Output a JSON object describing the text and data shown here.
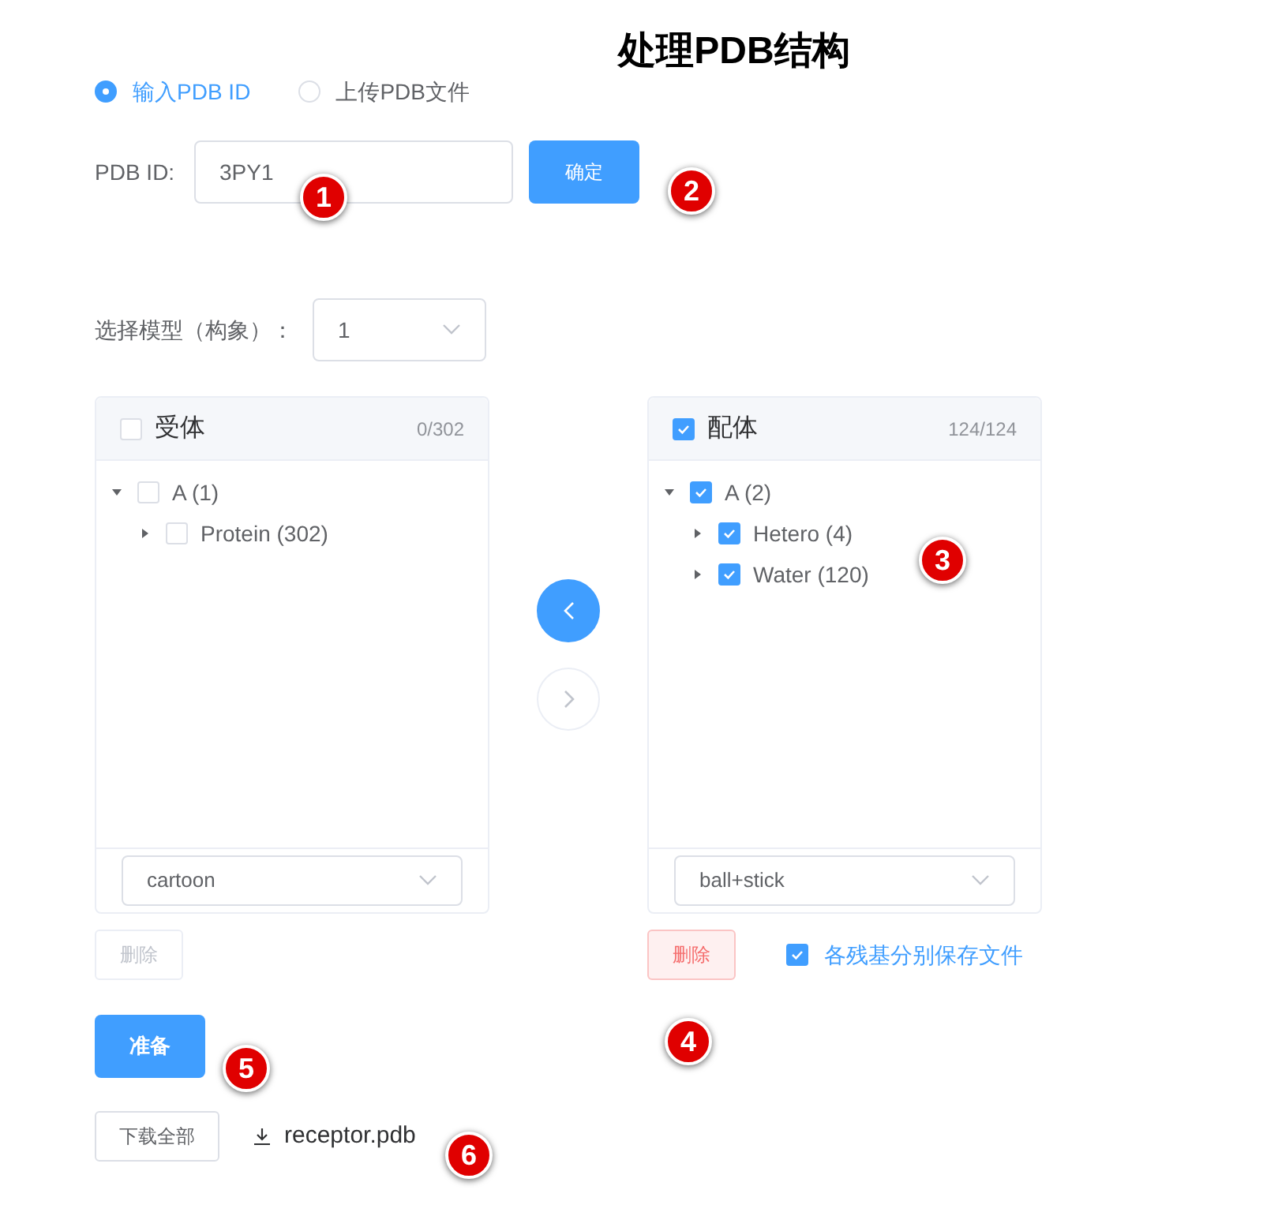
{
  "title": "处理PDB结构",
  "source_options": [
    {
      "label": "输入PDB ID",
      "selected": true
    },
    {
      "label": "上传PDB文件",
      "selected": false
    }
  ],
  "pdb_id": {
    "label": "PDB ID:",
    "value": "3PY1"
  },
  "confirm_button": "确定",
  "model": {
    "label": "选择模型（构象）：",
    "value": "1"
  },
  "panels": [
    {
      "title": "受体",
      "checked": false,
      "count": "0/302",
      "tree": [
        {
          "label": "A (1)",
          "checked": false,
          "expanded": true,
          "children": [
            {
              "label": "Protein (302)",
              "checked": false,
              "expanded": false
            }
          ]
        }
      ],
      "style": "cartoon",
      "delete_label": "删除",
      "delete_disabled": true
    },
    {
      "title": "配体",
      "checked": true,
      "count": "124/124",
      "tree": [
        {
          "label": "A (2)",
          "checked": true,
          "expanded": true,
          "children": [
            {
              "label": "Hetero (4)",
              "checked": true,
              "expanded": false
            },
            {
              "label": "Water (120)",
              "checked": true,
              "expanded": false
            }
          ]
        }
      ],
      "style": "ball+stick",
      "delete_label": "删除",
      "delete_disabled": false
    }
  ],
  "transfer_buttons": [
    {
      "kind": "left",
      "disabled": false
    },
    {
      "kind": "right",
      "disabled": true
    }
  ],
  "save_separately": {
    "label": "各残基分别保存文件",
    "checked": true
  },
  "prepare_button": "准备",
  "download_all_button": "下载全部",
  "file_link": "receptor.pdb",
  "callouts": [
    "1",
    "2",
    "3",
    "4",
    "5",
    "6"
  ]
}
